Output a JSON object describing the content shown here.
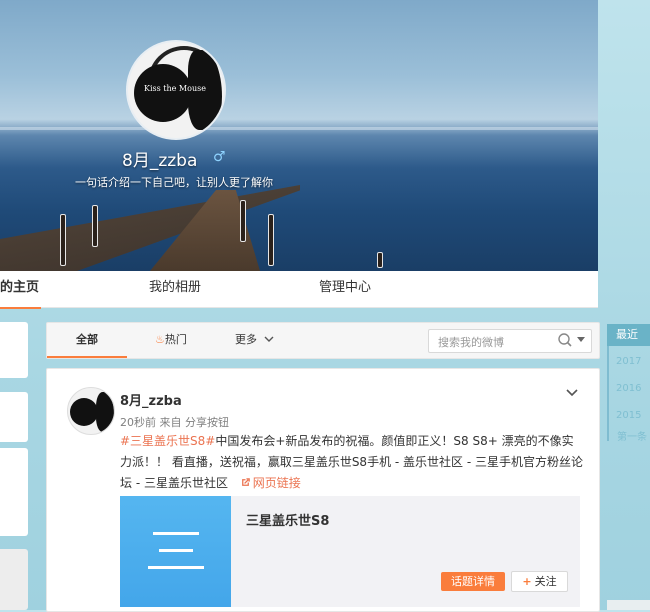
{
  "cover": {
    "nickname": "8月_zzba",
    "gender_symbol": "♂",
    "intro": "一句话介绍一下自己吧，让别人更了解你",
    "avatar_text": "Kiss the Mouse"
  },
  "nav": {
    "tabs": [
      "的主页",
      "我的相册",
      "管理中心"
    ],
    "active_index": 0
  },
  "feed_tabs": {
    "all": "全部",
    "hot": "热门",
    "more": "更多",
    "search_placeholder": "搜索我的微博"
  },
  "post": {
    "author": "8月_zzba",
    "meta": "20秒前 来自 分享按钮",
    "topic": "#三星盖乐世S8#",
    "text_after_topic": "中国发布会+新品发布的祝福。颜值即正义！S8 S8+ 漂亮的不像实力派！！ 看直播，送祝福，赢取三星盖乐世S8手机 - 盖乐世社区 - 三星手机官方粉丝论坛 - 三星盖乐世社区",
    "link_text": "网页链接",
    "card_title": "三星盖乐世S8",
    "topic_details_button": "话题详情",
    "follow_button": "关注"
  },
  "timeline": {
    "label": "最近",
    "years": [
      "2017",
      "2016",
      "2015"
    ],
    "first": "第一条"
  },
  "colors": {
    "accent": "#fa7d3c",
    "topic": "#eb7350",
    "card_blue": "#43a6ea",
    "timeline": "#6ab3c7"
  }
}
